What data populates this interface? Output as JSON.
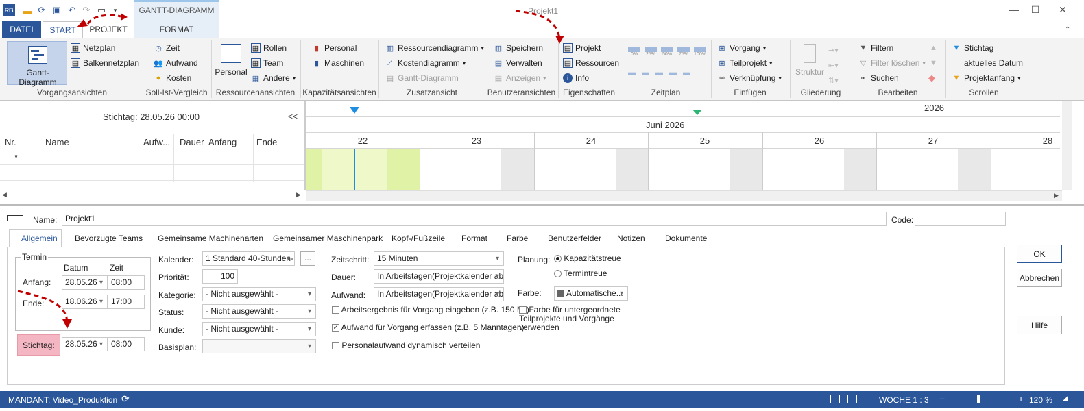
{
  "app": {
    "window_title": "Projekt1",
    "context_tab_group": "GANTT-DIAGRAMM",
    "logo_text": "RB"
  },
  "tabs": [
    {
      "label": "DATEI"
    },
    {
      "label": "START"
    },
    {
      "label": "PROJEKT"
    },
    {
      "label": "FORMAT"
    }
  ],
  "ribbon": {
    "vorgangsansichten": {
      "label": "Vorgangsansichten",
      "gantt": "Gantt-Diagramm",
      "netzplan": "Netzplan",
      "balkennetzplan": "Balkennetzplan"
    },
    "soll_ist": {
      "label": "Soll-Ist-Vergleich",
      "zeit": "Zeit",
      "aufwand": "Aufwand",
      "kosten": "Kosten"
    },
    "ressourcenansichten": {
      "label": "Ressourcenansichten",
      "personal": "Personal",
      "rollen": "Rollen",
      "team": "Team",
      "andere": "Andere"
    },
    "kapazitaet": {
      "label": "Kapazitätsansichten",
      "personal": "Personal",
      "maschinen": "Maschinen"
    },
    "zusatzansicht": {
      "label": "Zusatzansicht",
      "ressourcendiagramm": "Ressourcendiagramm",
      "kostendiagramm": "Kostendiagramm",
      "gantt": "Gantt-Diagramm"
    },
    "benutzeransichten": {
      "label": "Benutzeransichten",
      "speichern": "Speichern",
      "verwalten": "Verwalten",
      "anzeigen": "Anzeigen"
    },
    "eigenschaften": {
      "label": "Eigenschaften",
      "projekt": "Projekt",
      "ressourcen": "Ressourcen",
      "info": "Info"
    },
    "zeitplan": {
      "label": "Zeitplan",
      "pct": [
        "0%",
        "25%",
        "50%",
        "75%",
        "100%"
      ]
    },
    "einfuegen": {
      "label": "Einfügen",
      "vorgang": "Vorgang",
      "teilprojekt": "Teilprojekt",
      "verknuepfung": "Verknüpfung"
    },
    "gliederung": {
      "label": "Gliederung",
      "struktur": "Struktur"
    },
    "bearbeiten": {
      "label": "Bearbeiten",
      "filtern": "Filtern",
      "filter_loeschen": "Filter löschen",
      "suchen": "Suchen"
    },
    "scrollen": {
      "label": "Scrollen",
      "stichtag": "Stichtag",
      "aktuelles_datum": "aktuelles Datum",
      "projektanfang": "Projektanfang"
    }
  },
  "gantt": {
    "stichtag_label": "Stichtag: 28.05.26 00:00",
    "collapse": "<<",
    "columns": [
      "Nr.",
      "Name",
      "Aufw...",
      "Dauer",
      "Anfang",
      "Ende"
    ],
    "new_row_marker": "*",
    "year": "2026",
    "month": "Juni 2026",
    "days": [
      "22",
      "23",
      "24",
      "25",
      "26",
      "27",
      "28"
    ]
  },
  "details": {
    "name_label": "Name:",
    "name_value": "Projekt1",
    "code_label": "Code:",
    "code_value": "",
    "tabs": [
      "Allgemein",
      "Bevorzugte Teams",
      "Gemeinsame Machinenarten",
      "Gemeinsamer Maschinenpark",
      "Kopf-/Fußzeile",
      "Format",
      "Farbe",
      "Benutzerfelder",
      "Notizen",
      "Dokumente"
    ],
    "termin": {
      "group_label": "Termin",
      "datum_header": "Datum",
      "zeit_header": "Zeit",
      "anfang_label": "Anfang:",
      "anfang_datum": "28.05.26",
      "anfang_zeit": "08:00",
      "ende_label": "Ende:",
      "ende_datum": "18.06.26",
      "ende_zeit": "17:00",
      "stichtag_label": "Stichtag:",
      "stichtag_datum": "28.05.26",
      "stichtag_zeit": "08:00"
    },
    "kalender_label": "Kalender:",
    "kalender_value": "1 Standard 40-Stunden-",
    "kalender_btn": "...",
    "prioritaet_label": "Priorität:",
    "prioritaet_value": "100",
    "kategorie_label": "Kategorie:",
    "kategorie_value": "- Nicht ausgewählt -",
    "status_label": "Status:",
    "status_value": "- Nicht ausgewählt -",
    "kunde_label": "Kunde:",
    "kunde_value": "- Nicht ausgewählt -",
    "basisplan_label": "Basisplan:",
    "basisplan_value": "",
    "zeitschritt_label": "Zeitschritt:",
    "zeitschritt_value": "15 Minuten",
    "dauer_label": "Dauer:",
    "dauer_value": "In Arbeitstagen(Projektkalender abh",
    "aufwand_label": "Aufwand:",
    "aufwand_value": "In Arbeitstagen(Projektkalender abh",
    "chk_arbeitsergebnis": "Arbeitsergebnis für Vorgang eingeben (z.B. 150 M²)",
    "chk_aufwand": "Aufwand für Vorgang erfassen (z.B. 5 Manntagen)",
    "chk_personalaufwand": "Personalaufwand dynamisch verteilen",
    "planung_label": "Planung:",
    "radio_kapazitaet": "Kapazitätstreue",
    "radio_termintreue": "Termintreue",
    "farbe_label": "Farbe:",
    "farbe_value": "Automatische...",
    "chk_farbe_text": "Farbe für untergeordnete Teilprojekte und Vorgänge verwenden",
    "ok": "OK",
    "abbrechen": "Abbrechen",
    "hilfe": "Hilfe"
  },
  "status": {
    "mandant": "MANDANT: Video_Produktion",
    "woche": "WOCHE 1 : 3",
    "zoom": "120 %"
  },
  "colors": {
    "accent": "#2b579a",
    "annotation_red": "#c00000",
    "stichtag_highlight": "#f4b6c2",
    "today_marker": "#1f8de0",
    "green_marker": "#2bb673"
  }
}
